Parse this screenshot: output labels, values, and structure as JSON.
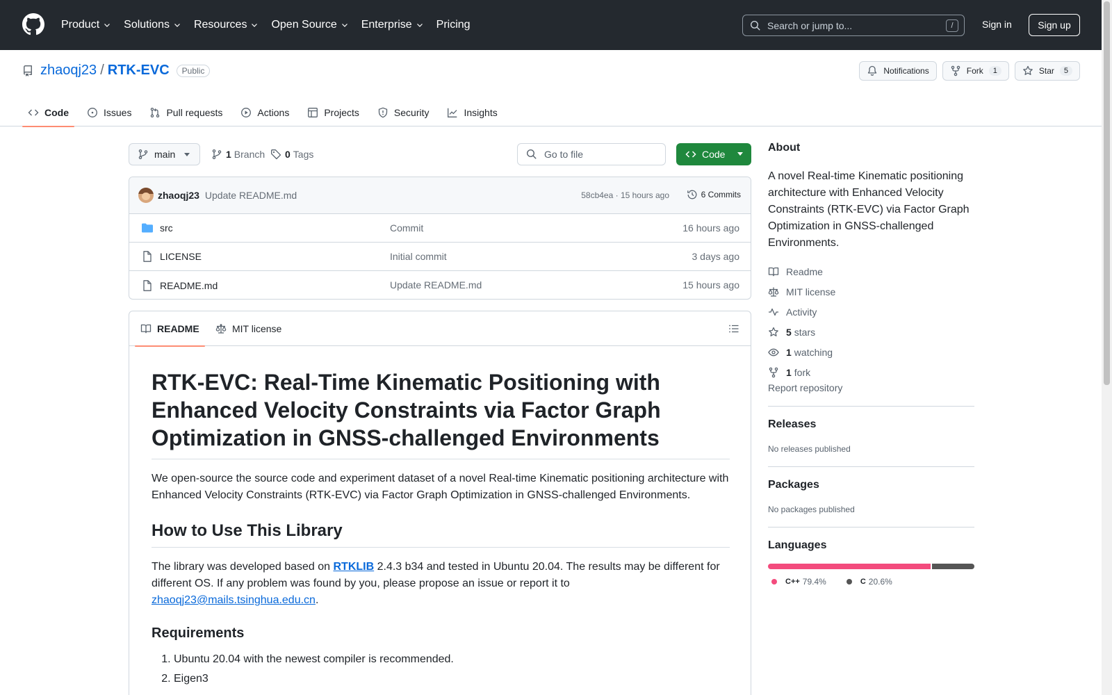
{
  "header": {
    "nav": [
      {
        "label": "Product",
        "chevron": true
      },
      {
        "label": "Solutions",
        "chevron": true
      },
      {
        "label": "Resources",
        "chevron": true
      },
      {
        "label": "Open Source",
        "chevron": true
      },
      {
        "label": "Enterprise",
        "chevron": true
      },
      {
        "label": "Pricing",
        "chevron": false
      }
    ],
    "search_placeholder": "Search or jump to...",
    "search_shortcut": "/",
    "sign_in": "Sign in",
    "sign_up": "Sign up"
  },
  "repo": {
    "owner": "zhaoqj23",
    "separator": "/",
    "name": "RTK-EVC",
    "visibility": "Public",
    "notifications_label": "Notifications",
    "fork_label": "Fork",
    "fork_count": "1",
    "star_label": "Star",
    "star_count": "5",
    "tabs": [
      "Code",
      "Issues",
      "Pull requests",
      "Actions",
      "Projects",
      "Security",
      "Insights"
    ]
  },
  "file_nav": {
    "branch": "main",
    "branch_count": "1",
    "branch_word": "Branch",
    "tag_count": "0",
    "tag_word": "Tags",
    "go_to_file": "Go to file",
    "code_button": "Code"
  },
  "latest_commit": {
    "author": "zhaoqj23",
    "message": "Update README.md",
    "meta": "58cb4ea · 15 hours ago",
    "commits_label": "6 Commits"
  },
  "files": [
    {
      "name": "src",
      "type": "folder",
      "message": "Commit",
      "age": "16 hours ago"
    },
    {
      "name": "LICENSE",
      "type": "file",
      "message": "Initial commit",
      "age": "3 days ago"
    },
    {
      "name": "README.md",
      "type": "file",
      "message": "Update README.md",
      "age": "15 hours ago"
    }
  ],
  "readme": {
    "tab_readme": "README",
    "tab_license": "MIT license",
    "title": "RTK-EVC: Real-Time Kinematic Positioning with Enhanced Velocity Constraints via Factor Graph Optimization in GNSS-challenged Environments",
    "intro": "We open-source the source code and experiment dataset of a novel Real-time Kinematic positioning architecture with Enhanced Velocity Constraints (RTK-EVC) via Factor Graph Optimization in GNSS-challenged Environments.",
    "h2_usage": "How to Use This Library",
    "usage_pre": "The library was developed based on ",
    "usage_link": "RTKLIB",
    "usage_post": " 2.4.3 b34 and tested in Ubuntu 20.04. The results may be different for different OS. If any problem was found by you, please propose an issue or report it to ",
    "email": "zhaoqj23@mails.tsinghua.edu.cn",
    "usage_end": ".",
    "h3_requirements": "Requirements",
    "requirements": [
      "Ubuntu 20.04 with the newest compiler is recommended.",
      "Eigen3"
    ]
  },
  "sidebar": {
    "about_title": "About",
    "description": "A novel Real-time Kinematic positioning architecture with Enhanced Velocity Constraints (RTK-EVC) via Factor Graph Optimization in GNSS-challenged Environments.",
    "readme": "Readme",
    "license": "MIT license",
    "activity": "Activity",
    "stars_count": "5",
    "stars_word": "stars",
    "watching_count": "1",
    "watching_word": "watching",
    "forks_count": "1",
    "forks_word": "fork",
    "report": "Report repository",
    "releases_title": "Releases",
    "releases_text": "No releases published",
    "packages_title": "Packages",
    "packages_text": "No packages published",
    "languages_title": "Languages",
    "languages": [
      {
        "name": "C++",
        "percent": "79.4%",
        "share": 79.4,
        "color": "#f34b7d"
      },
      {
        "name": "C",
        "percent": "20.6%",
        "share": 20.6,
        "color": "#555555"
      }
    ]
  },
  "colors": {
    "header_bg": "#24292f",
    "link": "#0969da",
    "code_button": "#1f883d",
    "tab_underline": "#fd8c73",
    "folder_icon": "#54aeff"
  }
}
